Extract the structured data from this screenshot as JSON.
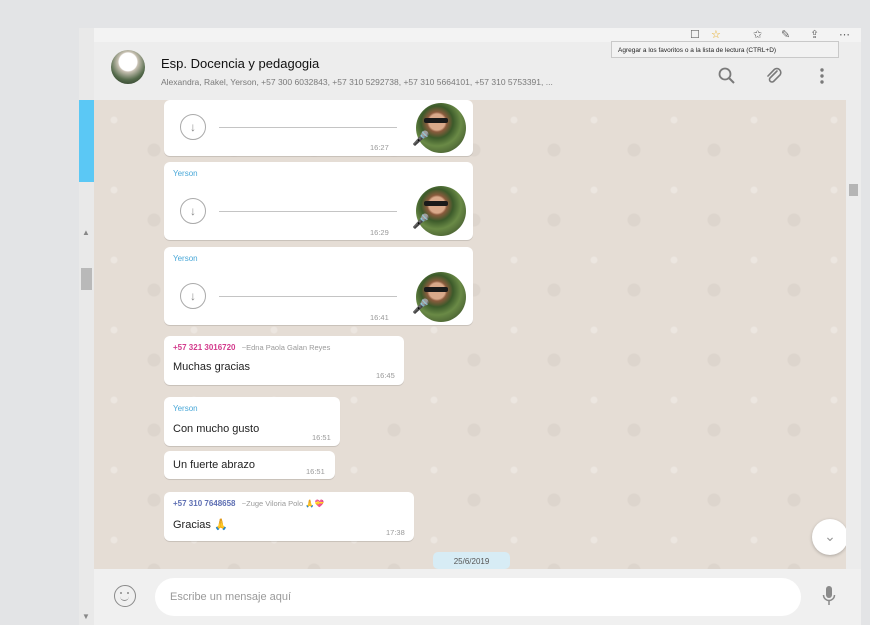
{
  "browser": {
    "tooltip": "Agregar a los favoritos o a la lista de lectura (CTRL+D)",
    "icons": [
      "square-icon",
      "star-icon",
      "favorites-icon",
      "pen-icon",
      "share-icon",
      "more-icon"
    ]
  },
  "chat": {
    "title": "Esp. Docencia y pedagogia",
    "members": "Alexandra, Rakel, Yerson, +57 300 6032843, +57 310 5292738, +57 310 5664101, +57 310 5753391, ...",
    "header_icons": [
      "search-icon",
      "attach-icon",
      "menu-icon"
    ]
  },
  "messages": [
    {
      "type": "voice",
      "sender": "",
      "time": "16:27"
    },
    {
      "type": "voice",
      "sender": "Yerson",
      "time": "16:29"
    },
    {
      "type": "voice",
      "sender": "Yerson",
      "time": "16:41"
    },
    {
      "type": "text",
      "sender": "+57 321 3016720",
      "subname": "~Edna Paola Galan Reyes",
      "text": "Muchas gracias",
      "time": "16:45"
    },
    {
      "type": "text",
      "sender": "Yerson",
      "text": "Con mucho gusto",
      "time": "16:51"
    },
    {
      "type": "text",
      "sender": "",
      "text": "Un fuerte abrazo",
      "time": "16:51"
    },
    {
      "type": "text",
      "sender": "+57 310 7648658",
      "subname": "~Zuge Viloria Polo 🙏💝",
      "text": "Gracias 🙏",
      "time": "17:38"
    }
  ],
  "date_divider": "25/6/2019",
  "composer": {
    "placeholder": "Escribe un mensaje aquí"
  },
  "colors": {
    "chat_bg": "#e5ddd5",
    "header_bg": "#ededed",
    "pink_sender": "#d33a8c",
    "blue_sender": "#4aa8d8",
    "mic_green": "#26c281"
  }
}
